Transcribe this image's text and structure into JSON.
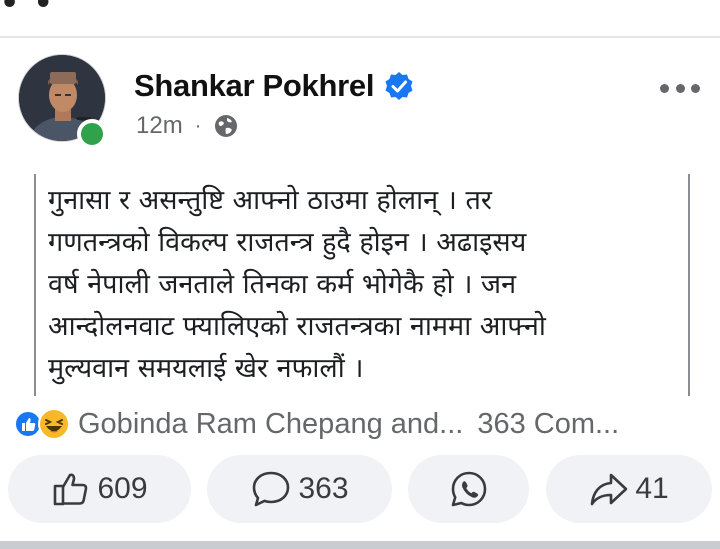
{
  "header": {
    "top_fragment": "• •"
  },
  "post": {
    "author": "Shankar Pokhrel",
    "verified": true,
    "timestamp": "12m",
    "separator": "·",
    "audience_icon": "globe-icon",
    "online": true,
    "text_lines": [
      "गुनासा र असन्तुष्टि आफ्नो ठाउमा होलान् । तर",
      "गणतन्त्रको विकल्प राजतन्त्र हुदै होइन । अढाइसय",
      "वर्ष नेपाली जनताले तिनका कर्म भोगेकै हो । जन",
      "आन्दोलनवाट फ्यालिएको राजतन्त्रका नाममा आफ्नो",
      "मुल्यवान समयलाई खेर नफालौं ।"
    ]
  },
  "reactions": {
    "icons": [
      "like-reaction-icon",
      "haha-reaction-icon"
    ],
    "names": "Gobinda Ram Chepang and...",
    "comments_summary": "363 Com..."
  },
  "actions": {
    "like_count": "609",
    "comment_count": "363",
    "share_count": "41"
  },
  "colors": {
    "facebook_blue": "#1877f2",
    "online_green": "#31a24c",
    "button_bg": "#f0f2f5",
    "muted_text": "#65676b"
  }
}
